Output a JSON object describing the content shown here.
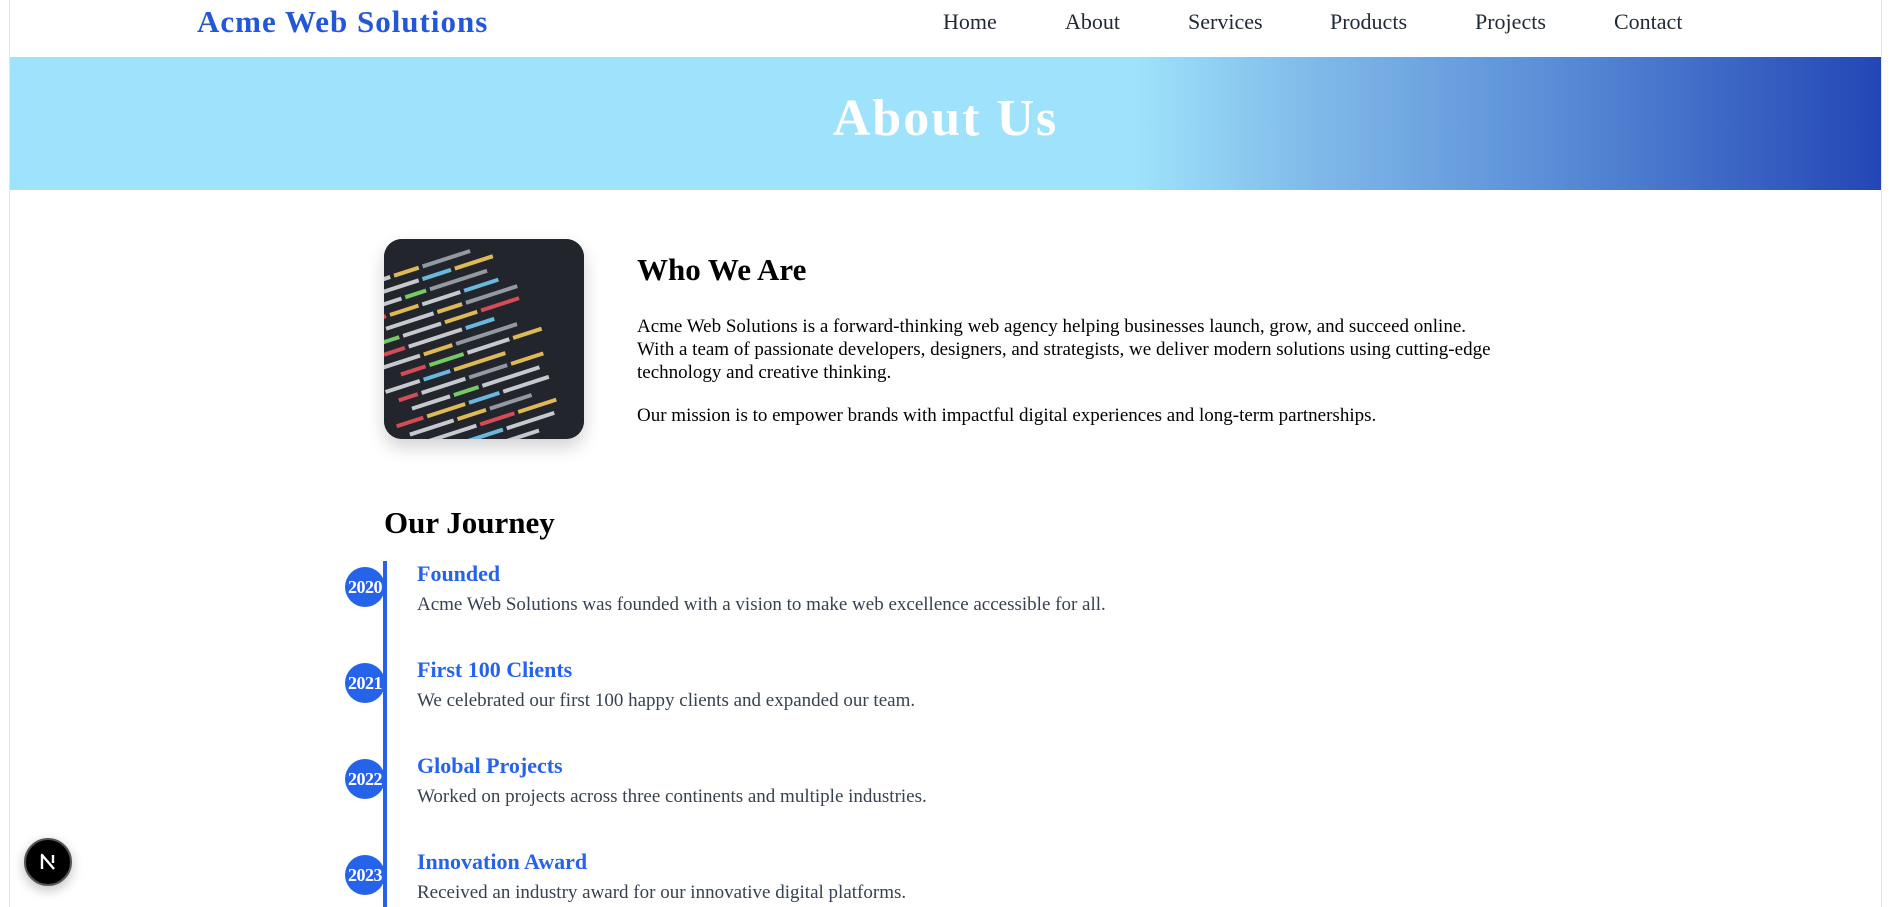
{
  "header": {
    "logo": "Acme Web Solutions",
    "nav": [
      {
        "label": "Home"
      },
      {
        "label": "About"
      },
      {
        "label": "Services"
      },
      {
        "label": "Products"
      },
      {
        "label": "Projects"
      },
      {
        "label": "Contact"
      }
    ]
  },
  "hero": {
    "title": "About Us"
  },
  "who": {
    "title": "Who We Are",
    "p1": "Acme Web Solutions is a forward-thinking web agency helping businesses launch, grow, and succeed online. With a team of passionate developers, designers, and strategists, we deliver modern solutions using cutting-edge technology and creative thinking.",
    "p2": "Our mission is to empower brands with impactful digital experiences and long-term partnerships."
  },
  "journey": {
    "title": "Our Journey",
    "items": [
      {
        "year": "2020",
        "heading": "Founded",
        "desc": "Acme Web Solutions was founded with a vision to make web excellence accessible for all."
      },
      {
        "year": "2021",
        "heading": "First 100 Clients",
        "desc": "We celebrated our first 100 happy clients and expanded our team."
      },
      {
        "year": "2022",
        "heading": "Global Projects",
        "desc": "Worked on projects across three continents and multiple industries."
      },
      {
        "year": "2023",
        "heading": "Innovation Award",
        "desc": "Received an industry award for our innovative digital platforms."
      }
    ]
  },
  "badge": {
    "icon": "nextjs-logo-icon",
    "letter": "N"
  },
  "colors": {
    "brand": "#2258d8",
    "accent": "#2563eb",
    "hero_start": "#9ee3fb",
    "hero_end": "#2346b5"
  }
}
